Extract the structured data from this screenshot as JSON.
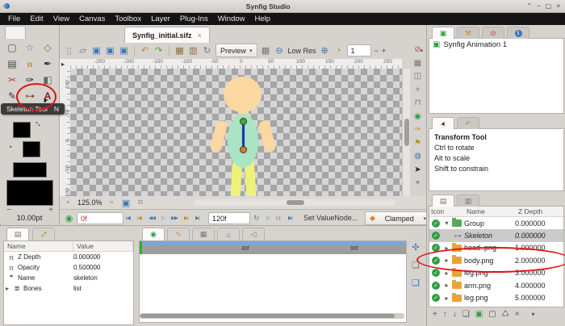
{
  "window": {
    "title": "Synfig Studio",
    "roll": "⌃",
    "minimize": "−",
    "maximize": "▢",
    "close": "×"
  },
  "menubar": {
    "items": [
      "File",
      "Edit",
      "View",
      "Canvas",
      "Toolbox",
      "Layer",
      "Plug-Ins",
      "Window",
      "Help"
    ]
  },
  "toolbox": {
    "tools": [
      {
        "glyph": "▢"
      },
      {
        "glyph": "☆"
      },
      {
        "glyph": "◇"
      },
      {
        "glyph": "▤"
      },
      {
        "glyph": "n"
      },
      {
        "glyph": "✒"
      },
      {
        "glyph": "✂"
      },
      {
        "glyph": "✑"
      },
      {
        "glyph": "◧"
      },
      {
        "glyph": "✎"
      },
      {
        "glyph": "⊶"
      },
      {
        "glyph": "A"
      }
    ],
    "tooltip_label": "Skeleton Tool",
    "tooltip_key": "N",
    "minus": "−",
    "plus": "+",
    "brush_size": "10.00pt"
  },
  "tabbar": {
    "title": "Synfig_initial.sifz",
    "close": "×"
  },
  "toolbar": {
    "icons": [
      "▯",
      "▱",
      "▣",
      "▣",
      "▣",
      "↶",
      "↷",
      "▦",
      "▥",
      "↻"
    ],
    "preview": "Preview",
    "caret": "▾",
    "render_opts": "▦",
    "zoom_out": "⊖",
    "low_res": "Low Res",
    "zoom_in": "⊕",
    "quality_icon": "◔",
    "quality": "1",
    "minus": "−",
    "plus": "+",
    "end_caret": "▾"
  },
  "hruler": {
    "labels": [
      "-250",
      "-200",
      "-150",
      "-100",
      "-50",
      "0",
      "50",
      "100",
      "150",
      "200",
      "250"
    ]
  },
  "vruler": {
    "labels": [
      "100",
      "50",
      "0",
      "-50",
      "-100"
    ]
  },
  "side_icons": [
    "⊘",
    "▦",
    "◫",
    "+",
    "⊓",
    "◉",
    "✑",
    "⚑",
    "◍",
    "➤",
    "⌖"
  ],
  "zoombar": {
    "fit": "▫",
    "zoom": "125.0%",
    "i1": "▫",
    "i2": "▣",
    "i3": "⌗"
  },
  "timebar": {
    "keyframe_icon": "◉",
    "current": "0f",
    "controls_left": [
      "|◀",
      "|◀",
      "◀◀",
      "▷",
      "▶▶",
      "▶|",
      "▶|"
    ],
    "end": "120f",
    "controls_right": [
      "↻",
      "▷",
      "▷|",
      "▶|"
    ],
    "set_valuenode": "Set ValueNode...",
    "interp_icon": "◆",
    "interpolation": "Clamped",
    "caret": "▾",
    "onion_past": "◍",
    "onion_future": "◍",
    "person": "♟"
  },
  "params": {
    "tab1": "▤",
    "tab2": "⊶",
    "col_name": "Name",
    "col_value": "Value",
    "rows": [
      {
        "icon": "π",
        "name": "Z Depth",
        "value": "0.000000"
      },
      {
        "icon": "π",
        "name": "Opacity",
        "value": "0.500000"
      },
      {
        "icon": "❞",
        "name": "Name",
        "value": "skeleton"
      },
      {
        "icon": "≣",
        "name": "Bones",
        "value": "list",
        "expander": "▸"
      }
    ]
  },
  "timetrack": {
    "tabs": [
      "◉",
      "∿",
      "▦",
      "⌂",
      "◁"
    ],
    "tick1": "48f",
    "tick2": "96f",
    "side": [
      "✣",
      "❏",
      "❏"
    ]
  },
  "canvases": {
    "tabs": [
      "▣",
      "⚒",
      "⊘",
      "i"
    ],
    "item": "Synfig Animation 1",
    "item_icon": "▣"
  },
  "tool_options": {
    "tab1": "➤",
    "tab2": "↶",
    "title": "Transform Tool",
    "hint1": "Ctrl to rotate",
    "hint2": "Alt to scale",
    "hint3": "Shift to constrain"
  },
  "layers": {
    "tab1": "▤",
    "tab2": "▥",
    "col_icon": "Icon",
    "col_name": "Name",
    "col_z": "Z Depth",
    "check": "✓",
    "expander_open": "▾",
    "expander_closed": "▸",
    "bone_glyph": "⊶",
    "rows": [
      {
        "name": "Group",
        "z": "0.000000"
      },
      {
        "name": "Skeleton",
        "z": "0.000000"
      },
      {
        "name": "head..png",
        "z": "1.000000"
      },
      {
        "name": "body.png",
        "z": "2.000000"
      },
      {
        "name": "leg.png",
        "z": "3.000000"
      },
      {
        "name": "arm.png",
        "z": "4.000000"
      },
      {
        "name": "leg.png",
        "z": "5.000000"
      }
    ],
    "buttons": [
      "+",
      "↑",
      "↓",
      "❏",
      "▣",
      "▢",
      "♺",
      "×",
      "▾"
    ]
  },
  "colors": {
    "annotation_red": "#dd1414",
    "selection_gray": "#cbcbcb",
    "head_skin": "#fbd7a2",
    "body_mint": "#a9e5c2",
    "legs_yellow": "#eef279",
    "bone_blue": "#223d8f",
    "timebar_blue": "#7aa7d8",
    "timebar_gray": "#9d9d9d"
  }
}
